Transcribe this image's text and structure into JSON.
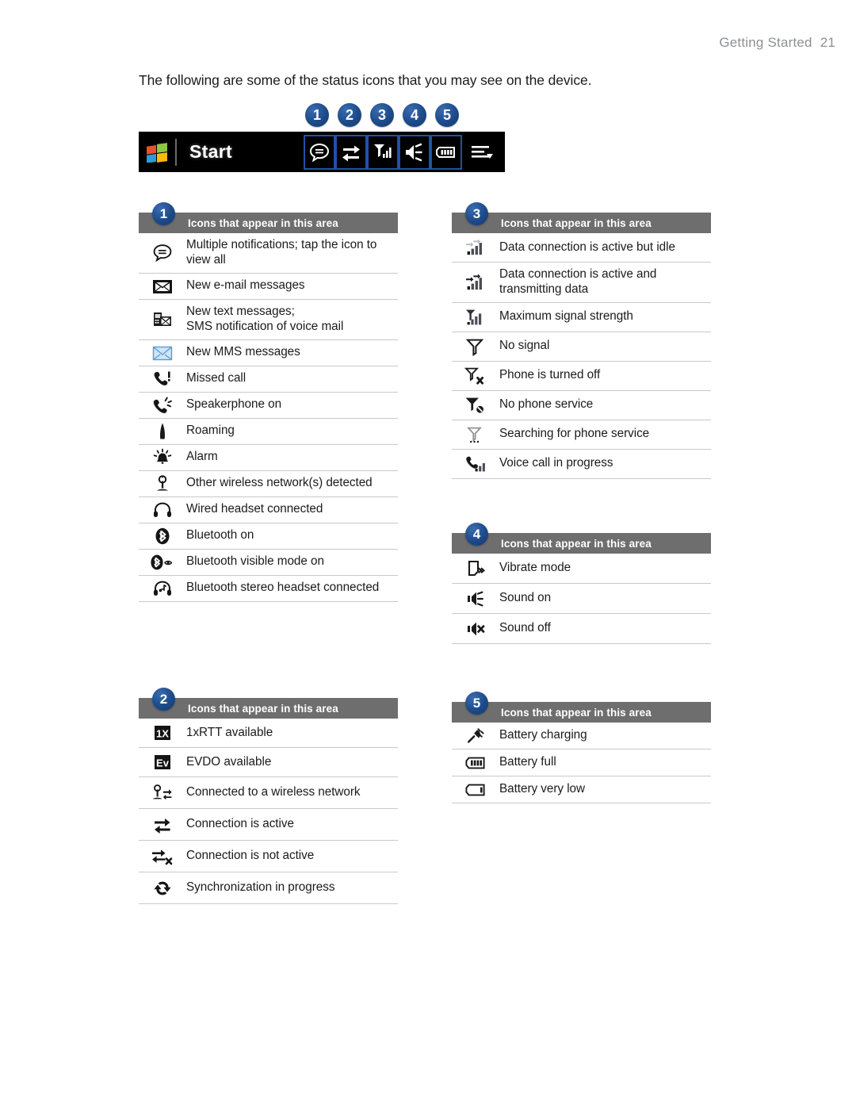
{
  "page_header": {
    "section": "Getting Started",
    "page_number": "21"
  },
  "intro": "The following are some of the status icons that you may see on the device.",
  "callouts": [
    "1",
    "2",
    "3",
    "4",
    "5"
  ],
  "taskbar": {
    "start_label": "Start",
    "logo_icon": "windows-logo-icon",
    "icons": [
      {
        "name": "notification-bubble-icon",
        "boxed": true
      },
      {
        "name": "connection-active-icon",
        "boxed": true
      },
      {
        "name": "signal-strength-icon",
        "boxed": true
      },
      {
        "name": "sound-on-icon",
        "boxed": true
      },
      {
        "name": "battery-full-icon",
        "boxed": true
      }
    ],
    "tail_icon": "input-panel-icon"
  },
  "common_header": "Icons that appear in this area",
  "sections": [
    {
      "number": "1",
      "header": "Icons that appear in this area",
      "rows": [
        {
          "icon": "multiple-notifications-icon",
          "label": "Multiple notifications; tap the icon to view all",
          "lines": 2
        },
        {
          "icon": "new-email-icon",
          "label": "New e-mail messages",
          "lines": 1
        },
        {
          "icon": "new-text-message-icon",
          "label": "New text messages;\nSMS notification of voice mail",
          "lines": 2
        },
        {
          "icon": "new-mms-icon",
          "label": "New MMS messages",
          "lines": 1
        },
        {
          "icon": "missed-call-icon",
          "label": "Missed call",
          "lines": 1
        },
        {
          "icon": "speakerphone-on-icon",
          "label": "Speakerphone on",
          "lines": 1
        },
        {
          "icon": "roaming-icon",
          "label": "Roaming",
          "lines": 1
        },
        {
          "icon": "alarm-icon",
          "label": "Alarm",
          "lines": 1
        },
        {
          "icon": "wireless-network-detected-icon",
          "label": "Other wireless network(s) detected",
          "lines": 1
        },
        {
          "icon": "wired-headset-icon",
          "label": "Wired headset connected",
          "lines": 1
        },
        {
          "icon": "bluetooth-on-icon",
          "label": "Bluetooth on",
          "lines": 1
        },
        {
          "icon": "bluetooth-visible-icon",
          "label": "Bluetooth visible mode on",
          "lines": 1
        },
        {
          "icon": "bluetooth-stereo-headset-icon",
          "label": "Bluetooth stereo headset connected",
          "lines": 1
        }
      ]
    },
    {
      "number": "2",
      "header": "Icons that appear in this area",
      "rows": [
        {
          "icon": "1xrtt-available-icon",
          "label": "1xRTT available",
          "lines": 1
        },
        {
          "icon": "evdo-available-icon",
          "label": "EVDO available",
          "lines": 1
        },
        {
          "icon": "connected-wireless-network-icon",
          "label": "Connected to a wireless network",
          "lines": 1
        },
        {
          "icon": "connection-active-icon",
          "label": "Connection is active",
          "lines": 1
        },
        {
          "icon": "connection-not-active-icon",
          "label": "Connection is not active",
          "lines": 1
        },
        {
          "icon": "sync-in-progress-icon",
          "label": "Synchronization in progress",
          "lines": 1
        }
      ]
    },
    {
      "number": "3",
      "header": "Icons that appear in this area",
      "rows": [
        {
          "icon": "data-connection-idle-icon",
          "label": "Data connection is active but idle",
          "lines": 1
        },
        {
          "icon": "data-connection-transmitting-icon",
          "label": "Data connection is active and\ntransmitting data",
          "lines": 2
        },
        {
          "icon": "max-signal-strength-icon",
          "label": "Maximum signal strength",
          "lines": 1
        },
        {
          "icon": "no-signal-icon",
          "label": "No signal",
          "lines": 1
        },
        {
          "icon": "phone-off-icon",
          "label": "Phone is turned off",
          "lines": 1
        },
        {
          "icon": "no-phone-service-icon",
          "label": "No phone service",
          "lines": 1
        },
        {
          "icon": "searching-phone-service-icon",
          "label": "Searching for phone service",
          "lines": 1
        },
        {
          "icon": "voice-call-in-progress-icon",
          "label": "Voice call in progress",
          "lines": 1
        }
      ]
    },
    {
      "number": "4",
      "header": "Icons that appear in this area",
      "rows": [
        {
          "icon": "vibrate-mode-icon",
          "label": "Vibrate mode",
          "lines": 1
        },
        {
          "icon": "sound-on-icon",
          "label": "Sound on",
          "lines": 1
        },
        {
          "icon": "sound-off-icon",
          "label": "Sound off",
          "lines": 1
        }
      ]
    },
    {
      "number": "5",
      "header": "Icons that appear in this area",
      "rows": [
        {
          "icon": "battery-charging-icon",
          "label": "Battery charging",
          "lines": 1
        },
        {
          "icon": "battery-full-icon",
          "label": "Battery full",
          "lines": 1
        },
        {
          "icon": "battery-very-low-icon",
          "label": "Battery very low",
          "lines": 1
        }
      ]
    }
  ],
  "colors": {
    "badge_blue": "#1d4a88",
    "header_gray": "#6e6e6e",
    "taskbar_black": "#000000",
    "box_outline_blue": "#2250a8",
    "page_header_gray": "#8d9194",
    "rule_gray": "#c9c9c9"
  }
}
